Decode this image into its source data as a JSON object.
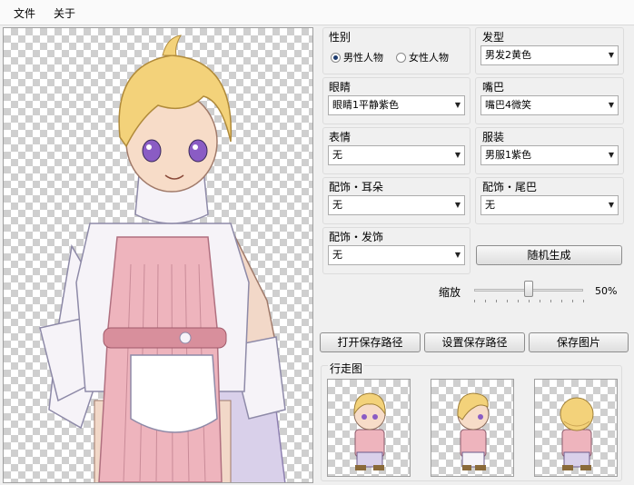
{
  "menu": {
    "file": "文件",
    "about": "关于"
  },
  "gender": {
    "label": "性别",
    "male": "男性人物",
    "female": "女性人物",
    "selected": "male"
  },
  "hair": {
    "label": "发型",
    "value": "男发2黄色"
  },
  "eyes": {
    "label": "眼睛",
    "value": "眼睛1平静紫色"
  },
  "mouth": {
    "label": "嘴巴",
    "value": "嘴巴4微笑"
  },
  "expression": {
    "label": "表情",
    "value": "无"
  },
  "clothing": {
    "label": "服装",
    "value": "男服1紫色"
  },
  "acc_ears": {
    "label": "配饰・耳朵",
    "value": "无"
  },
  "acc_tail": {
    "label": "配饰・尾巴",
    "value": "无"
  },
  "acc_hair": {
    "label": "配饰・发饰",
    "value": "无"
  },
  "random_button": "随机生成",
  "zoom": {
    "label": "缩放",
    "value_text": "50%",
    "value": 50
  },
  "buttons": {
    "open_path": "打开保存路径",
    "set_path": "设置保存路径",
    "save_image": "保存图片"
  },
  "walk": {
    "label": "行走图"
  },
  "colors": {
    "hair": "#f3d27a",
    "eyes": "#8a5cc4",
    "pink": "#eeb4bd",
    "white": "#f6f3f8",
    "lavender": "#d9d0ea"
  }
}
